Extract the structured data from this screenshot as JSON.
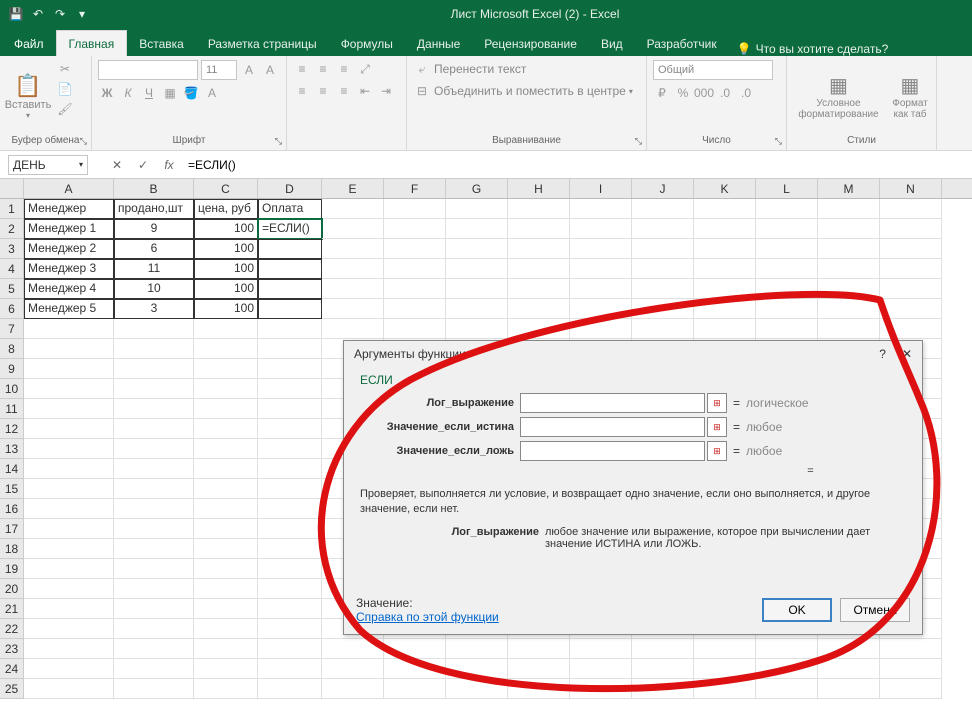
{
  "app": {
    "title": "Лист Microsoft Excel (2) - Excel"
  },
  "qat": {
    "save": "💾",
    "undo": "↶",
    "redo": "↷"
  },
  "tabs": {
    "file": "Файл",
    "home": "Главная",
    "insert": "Вставка",
    "pagelayout": "Разметка страницы",
    "formulas": "Формулы",
    "data": "Данные",
    "review": "Рецензирование",
    "view": "Вид",
    "developer": "Разработчик",
    "tellme": "Что вы хотите сделать?"
  },
  "ribbon": {
    "clipboard": {
      "paste": "Вставить",
      "label": "Буфер обмена"
    },
    "font": {
      "label": "Шрифт",
      "size": "11",
      "bold": "Ж",
      "italic": "К",
      "underline": "Ч"
    },
    "alignment": {
      "label": "Выравнивание",
      "wrap": "Перенести текст",
      "merge": "Объединить и поместить в центре"
    },
    "number": {
      "label": "Число",
      "format": "Общий"
    },
    "styles": {
      "label": "Стили",
      "conditional": "Условное форматирование",
      "format_table": "Формат как таб"
    }
  },
  "formula_bar": {
    "name_box": "ДЕНЬ",
    "formula": "=ЕСЛИ()"
  },
  "columns": [
    "A",
    "B",
    "C",
    "D",
    "E",
    "F",
    "G",
    "H",
    "I",
    "J",
    "K",
    "L",
    "M",
    "N"
  ],
  "table": {
    "headers": [
      "Менеджер",
      "продано,шт",
      "цена, руб",
      "Оплата"
    ],
    "rows": [
      [
        "Менеджер 1",
        "9",
        "100",
        "=ЕСЛИ()"
      ],
      [
        "Менеджер 2",
        "6",
        "100",
        ""
      ],
      [
        "Менеджер 3",
        "11",
        "100",
        ""
      ],
      [
        "Менеджер 4",
        "10",
        "100",
        ""
      ],
      [
        "Менеджер 5",
        "3",
        "100",
        ""
      ]
    ]
  },
  "dialog": {
    "title": "Аргументы функции",
    "fn": "ЕСЛИ",
    "args": {
      "logical": {
        "label": "Лог_выражение",
        "value": "",
        "type": "логическое"
      },
      "iftrue": {
        "label": "Значение_если_истина",
        "value": "",
        "type": "любое"
      },
      "iffalse": {
        "label": "Значение_если_ложь",
        "value": "",
        "type": "любое"
      }
    },
    "description": "Проверяет, выполняется ли условие, и возвращает одно значение, если оно выполняется, и другое значение, если нет.",
    "arg_desc_label": "Лог_выражение",
    "arg_desc": "любое значение или выражение, которое при вычислении дает значение ИСТИНА или ЛОЖЬ.",
    "value_label": "Значение:",
    "help_link": "Справка по этой функции",
    "ok": "OK",
    "cancel": "Отмена"
  }
}
